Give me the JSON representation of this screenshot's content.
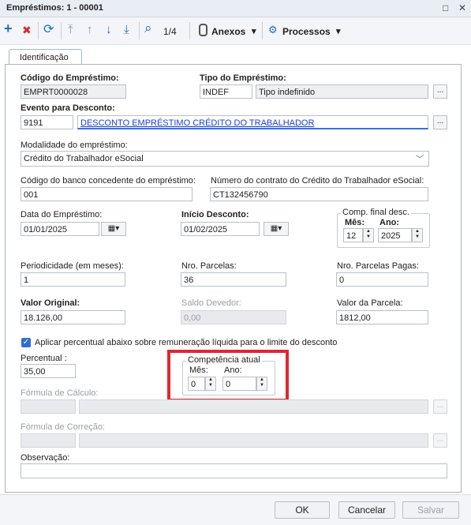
{
  "window": {
    "title": "Empréstimos: 1 - 00001",
    "restore_glyph": "□",
    "close_glyph": "✕"
  },
  "toolbar": {
    "icons": {
      "add": "+",
      "delete": "✖",
      "refresh": "⟳",
      "first": "⤒",
      "prev": "↑",
      "next": "↓",
      "last": "⤓",
      "search": "⌕"
    },
    "record_position": "1/4",
    "anexos_label": "Anexos",
    "processos_label": "Processos",
    "dropdown_glyph": "▾"
  },
  "tabs": [
    {
      "label": "Identificação"
    }
  ],
  "form": {
    "codigo_emprestimo": {
      "label": "Código do Empréstimo:",
      "value": "EMPRT0000028"
    },
    "tipo_emprestimo": {
      "label": "Tipo do Empréstimo:",
      "code": "INDEF",
      "description": "Tipo indefinido"
    },
    "evento_desconto": {
      "label": "Evento para Desconto:",
      "code": "9191",
      "description": "DESCONTO EMPRÉSTIMO CRÉDITO DO TRABALHADOR"
    },
    "modalidade": {
      "label": "Modalidade do empréstimo:",
      "value": "Crédito do Trabalhador eSocial"
    },
    "codigo_banco": {
      "label": "Código do banco concedente do empréstimo:",
      "value": "001"
    },
    "numero_contrato": {
      "label": "Número do contrato do Crédito do Trabalhador eSocial:",
      "value": "CT132456790"
    },
    "data_emprestimo": {
      "label": "Data do Empréstimo:",
      "value": "01/01/2025"
    },
    "inicio_desconto": {
      "label": "Início Desconto:",
      "value": "01/02/2025"
    },
    "comp_final": {
      "label": "Comp. final desc.",
      "mes_label": "Mês:",
      "ano_label": "Ano:",
      "mes": "12",
      "ano": "2025"
    },
    "periodicidade": {
      "label": "Periodicidade (em meses):",
      "value": "1"
    },
    "nro_parcelas": {
      "label": "Nro. Parcelas:",
      "value": "36"
    },
    "nro_parcelas_pagas": {
      "label": "Nro. Parcelas Pagas:",
      "value": "0"
    },
    "valor_original": {
      "label": "Valor Original:",
      "value": "18.126,00"
    },
    "saldo_devedor": {
      "label": "Saldo Devedor:",
      "value": "0,00"
    },
    "valor_parcela": {
      "label": "Valor da Parcela:",
      "value": "1812,00"
    },
    "aplicar_percentual": {
      "label": "Aplicar percentual abaixo sobre remuneração líquida para o limite do desconto",
      "checked": true
    },
    "percentual": {
      "label": "Percentual :",
      "value": "35,00"
    },
    "competencia_atual": {
      "label": "Competência atual",
      "mes_label": "Mês:",
      "ano_label": "Ano:",
      "mes": "0",
      "ano": "0"
    },
    "formula_calculo": {
      "label": "Fórmula de Cálculo:"
    },
    "formula_correcao": {
      "label": "Fórmula de Correção:"
    },
    "observacao": {
      "label": "Observação:",
      "value": ""
    }
  },
  "glyphs": {
    "dots": "...",
    "chevron": "﹀",
    "calendar": "▦▾",
    "spin_up": "▲",
    "spin_down": "▼",
    "check": "✓"
  },
  "footer": {
    "ok_label": "OK",
    "cancel_label": "Cancelar",
    "save_label": "Salvar"
  },
  "colors": {
    "link": "#1a3fd6",
    "highlight": "#e3262c",
    "checkbox": "#2f6fd1",
    "add_icon": "#1f6fc5",
    "delete_icon": "#d32f2f"
  }
}
